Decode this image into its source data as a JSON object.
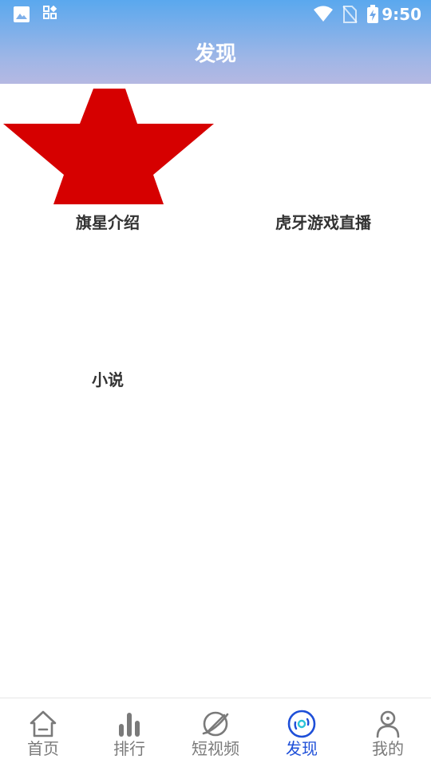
{
  "status_bar": {
    "time": "9:50",
    "left_icons": [
      "image-icon",
      "grid-app-icon"
    ],
    "right_icons": [
      "wifi-icon",
      "no-sim-icon",
      "battery-charging-icon"
    ]
  },
  "header": {
    "title": "发现"
  },
  "discover": {
    "items": [
      {
        "label": "旗星介绍",
        "icon": "red-star-icon"
      },
      {
        "label": "虎牙游戏直播"
      },
      {
        "label": "小说"
      }
    ]
  },
  "tabbar": {
    "tabs": [
      {
        "label": "首页",
        "icon": "home-icon",
        "active": false
      },
      {
        "label": "排行",
        "icon": "bar-chart-icon",
        "active": false
      },
      {
        "label": "短视频",
        "icon": "planet-icon",
        "active": false
      },
      {
        "label": "发现",
        "icon": "disc-icon",
        "active": true
      },
      {
        "label": "我的",
        "icon": "person-icon",
        "active": false
      }
    ]
  },
  "colors": {
    "header_gradient_top": "#5aa8ee",
    "header_gradient_bottom": "#b5b8e2",
    "active_tab": "#1e4fd8",
    "inactive_tab": "#7a7a7a",
    "star": "#d60000"
  }
}
